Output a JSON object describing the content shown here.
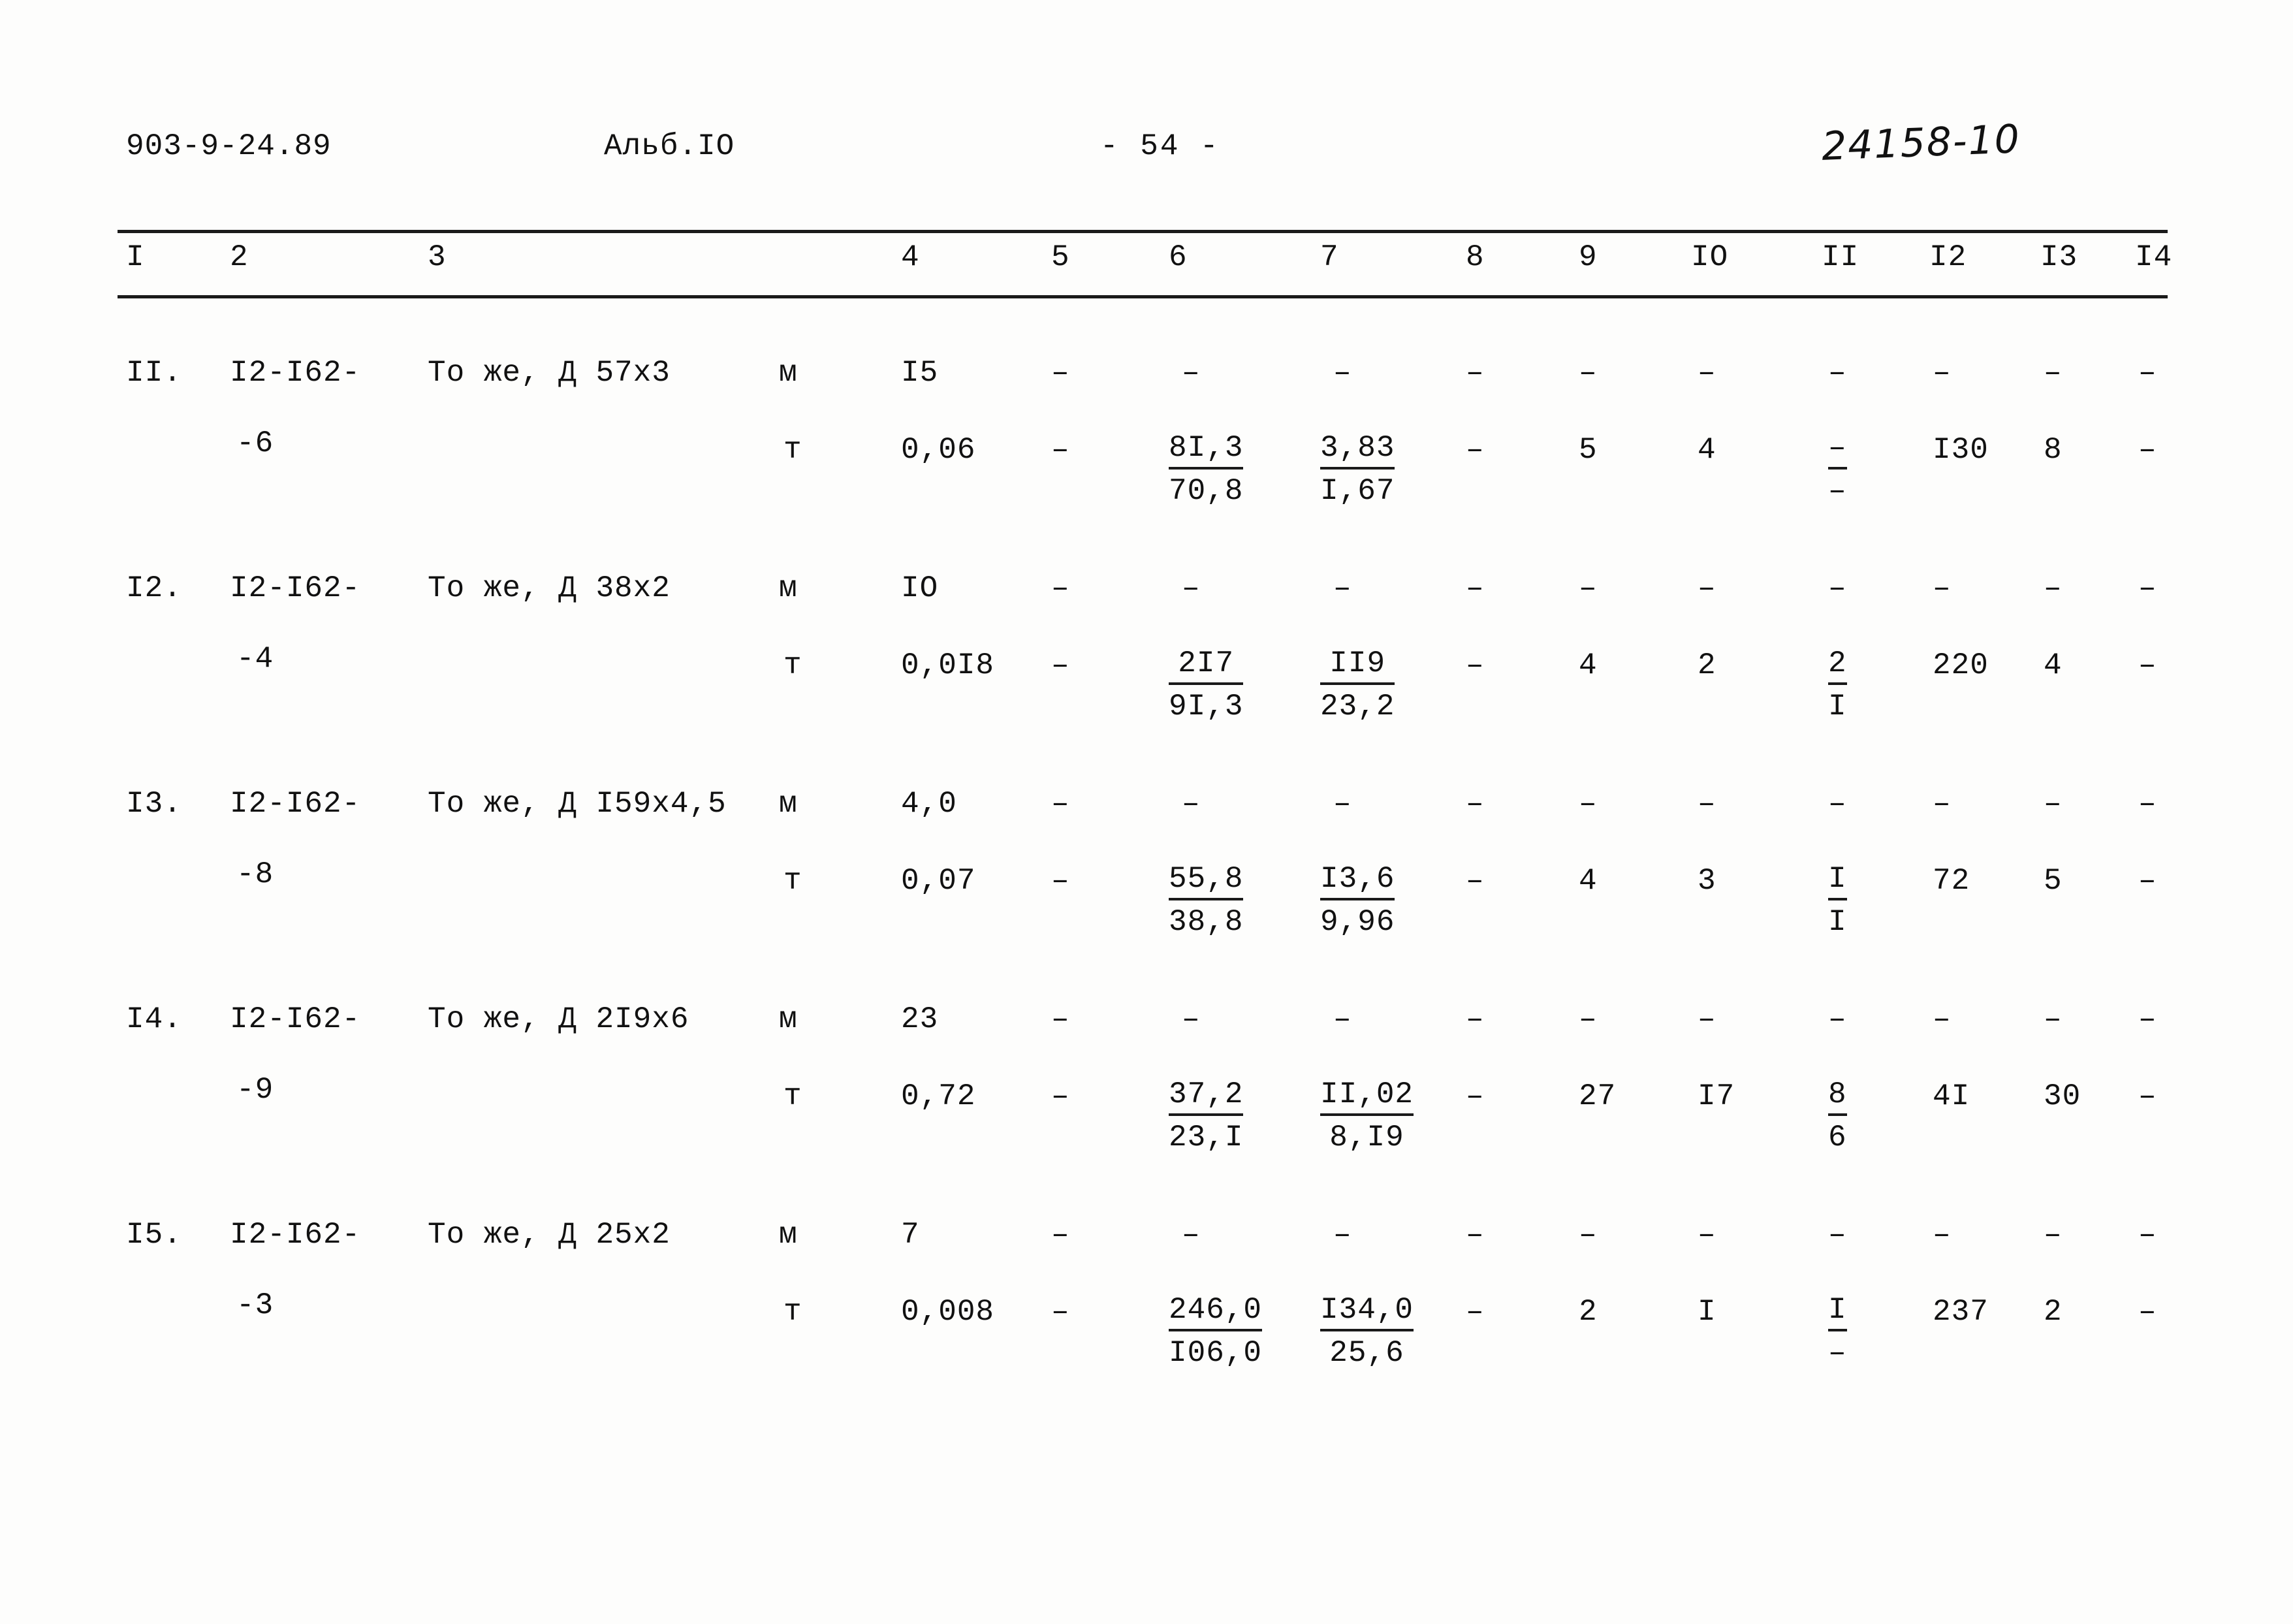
{
  "header": {
    "doc_code": "903-9-24.89",
    "album": "Альб.IO",
    "page_number": "- 54 -",
    "handwritten_note": "24158-10"
  },
  "table": {
    "column_headers": [
      "I",
      "2",
      "3",
      "4",
      "5",
      "6",
      "7",
      "8",
      "9",
      "IO",
      "II",
      "I2",
      "I3",
      "I4"
    ],
    "rows": [
      {
        "no": "II.",
        "code_line1": "I2-I62-",
        "code_line2": "-6",
        "description": "То же, Д 57х3",
        "unit_m": "м",
        "unit_t": "т",
        "m": {
          "c4": "I5",
          "c5": "–",
          "c6": "–",
          "c7": "–",
          "c8": "–",
          "c9": "–",
          "c10": "–",
          "c11": "–",
          "c12": "–",
          "c13": "–",
          "c14": "–"
        },
        "t": {
          "c4": "0,06",
          "c5": "–",
          "c6_num": "8I,3",
          "c6_den": "70,8",
          "c7_num": "3,83",
          "c7_den": "I,67",
          "c8": "–",
          "c9": "5",
          "c10": "4",
          "c11_num": "–",
          "c11_den": "–",
          "c12": "I30",
          "c13": "8",
          "c14": "–"
        }
      },
      {
        "no": "I2.",
        "code_line1": "I2-I62-",
        "code_line2": "-4",
        "description": "То же, Д 38х2",
        "unit_m": "м",
        "unit_t": "т",
        "m": {
          "c4": "IO",
          "c5": "–",
          "c6": "–",
          "c7": "–",
          "c8": "–",
          "c9": "–",
          "c10": "–",
          "c11": "–",
          "c12": "–",
          "c13": "–",
          "c14": "–"
        },
        "t": {
          "c4": "0,0I8",
          "c5": "–",
          "c6_num": "2I7",
          "c6_den": "9I,3",
          "c7_num": "II9",
          "c7_den": "23,2",
          "c8": "–",
          "c9": "4",
          "c10": "2",
          "c11_num": "2",
          "c11_den": "I",
          "c12": "220",
          "c13": "4",
          "c14": "–"
        }
      },
      {
        "no": "I3.",
        "code_line1": "I2-I62-",
        "code_line2": "-8",
        "description": "То же, Д I59х4,5",
        "unit_m": "м",
        "unit_t": "т",
        "m": {
          "c4": "4,0",
          "c5": "–",
          "c6": "–",
          "c7": "–",
          "c8": "–",
          "c9": "–",
          "c10": "–",
          "c11": "–",
          "c12": "–",
          "c13": "–",
          "c14": "–"
        },
        "t": {
          "c4": "0,07",
          "c5": "–",
          "c6_num": "55,8",
          "c6_den": "38,8",
          "c7_num": "I3,6",
          "c7_den": "9,96",
          "c8": "–",
          "c9": "4",
          "c10": "3",
          "c11_num": "I",
          "c11_den": "I",
          "c12": "72",
          "c13": "5",
          "c14": "–"
        }
      },
      {
        "no": "I4.",
        "code_line1": "I2-I62-",
        "code_line2": "-9",
        "description": "То же, Д 2I9х6",
        "unit_m": "м",
        "unit_t": "т",
        "m": {
          "c4": "23",
          "c5": "–",
          "c6": "–",
          "c7": "–",
          "c8": "–",
          "c9": "–",
          "c10": "–",
          "c11": "–",
          "c12": "–",
          "c13": "–",
          "c14": "–"
        },
        "t": {
          "c4": "0,72",
          "c5": "–",
          "c6_num": "37,2",
          "c6_den": "23,I",
          "c7_num": "II,02",
          "c7_den": "8,I9",
          "c8": "–",
          "c9": "27",
          "c10": "I7",
          "c11_num": "8",
          "c11_den": "6",
          "c12": "4I",
          "c13": "30",
          "c14": "–"
        }
      },
      {
        "no": "I5.",
        "code_line1": "I2-I62-",
        "code_line2": "-3",
        "description": "То же, Д 25х2",
        "unit_m": "м",
        "unit_t": "т",
        "m": {
          "c4": "7",
          "c5": "–",
          "c6": "–",
          "c7": "–",
          "c8": "–",
          "c9": "–",
          "c10": "–",
          "c11": "–",
          "c12": "–",
          "c13": "–",
          "c14": "–"
        },
        "t": {
          "c4": "0,008",
          "c5": "–",
          "c6_num": "246,0",
          "c6_den": "I06,0",
          "c7_num": "I34,0",
          "c7_den": "25,6",
          "c8": "–",
          "c9": "2",
          "c10": "I",
          "c11_num": "I",
          "c11_den": "–",
          "c12": "237",
          "c13": "2",
          "c14": "–"
        }
      }
    ]
  }
}
